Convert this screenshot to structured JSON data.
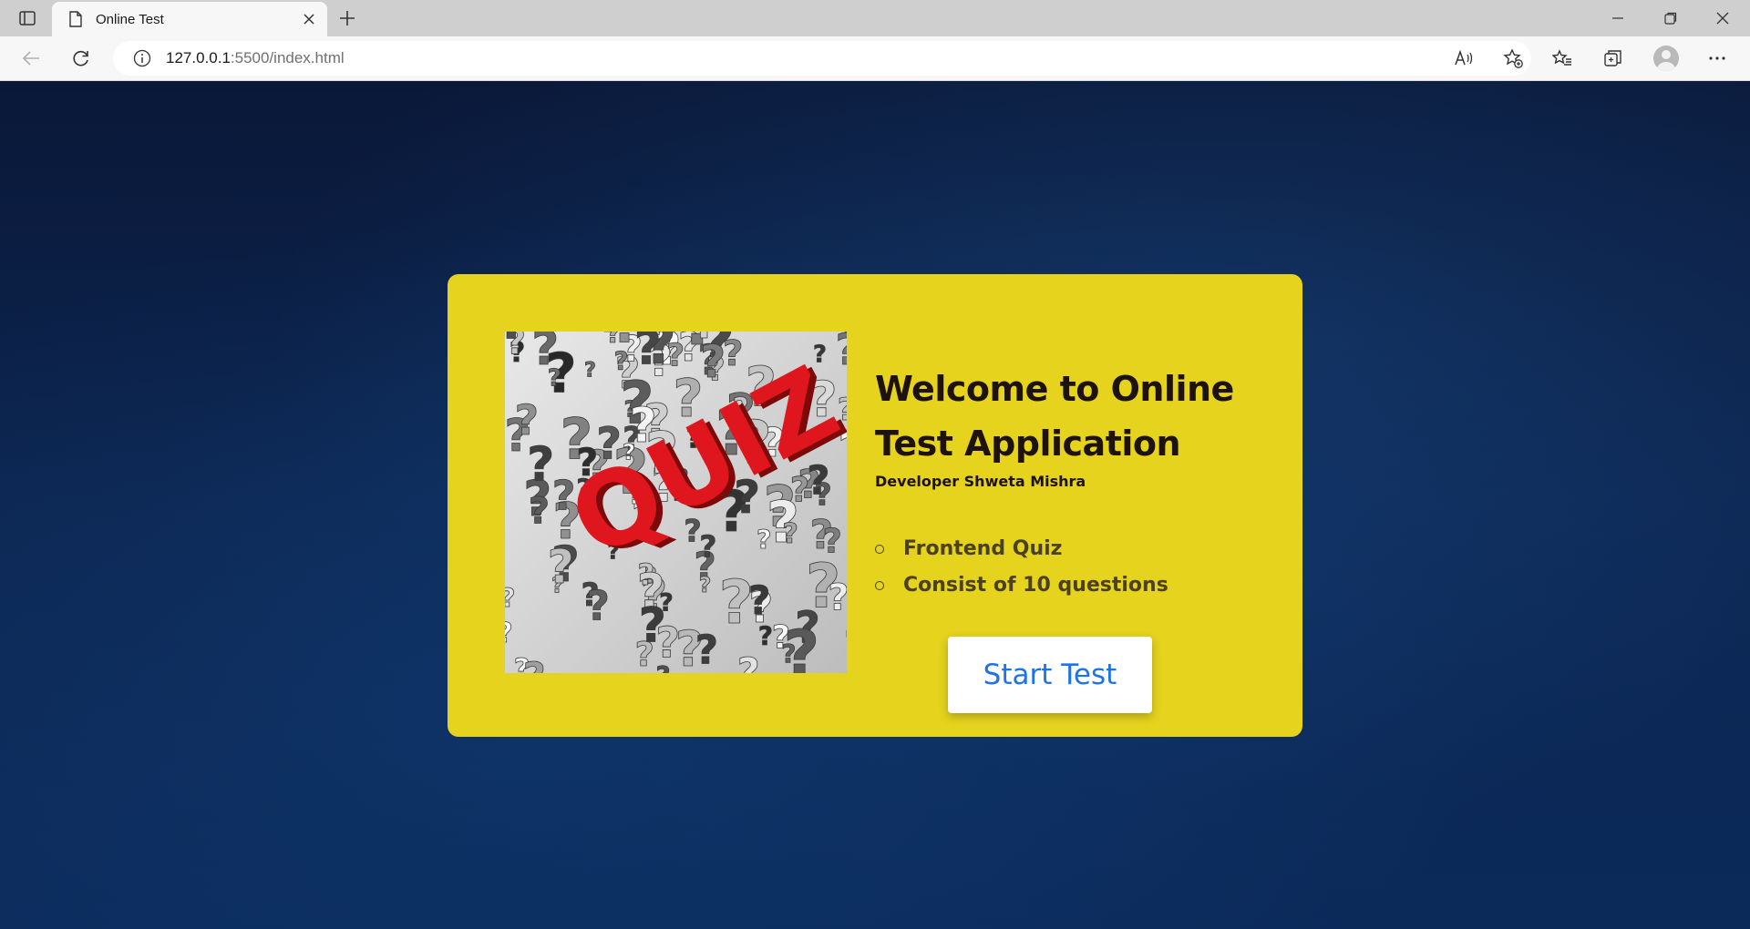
{
  "browser": {
    "tab_title": "Online Test",
    "url_host": "127.0.0.1",
    "url_rest": ":5500/index.html",
    "icons": {
      "tab_actions": "tab-actions-icon",
      "favicon": "page-icon",
      "tab_close": "close-icon",
      "new_tab": "plus-icon",
      "minimize": "minimize-icon",
      "restore": "restore-icon",
      "close_window": "close-icon",
      "back": "back-arrow-icon",
      "refresh": "refresh-icon",
      "site_info": "info-icon",
      "read_aloud": "read-aloud-icon",
      "add_favorite": "star-add-icon",
      "favorites": "favorites-icon",
      "collections": "collections-icon",
      "profile": "avatar",
      "menu": "more-icon"
    }
  },
  "page": {
    "title": "Welcome to Online Test Application",
    "developer": "Developer Shweta Mishra",
    "points": [
      "Frontend Quiz",
      "Consist of 10 questions"
    ],
    "start_button": "Start Test",
    "image_text": "QUIZ",
    "colors": {
      "card": "#e5d31d",
      "button_text": "#1e73e8",
      "title": "#1d120d",
      "background": "#0c2550"
    }
  }
}
